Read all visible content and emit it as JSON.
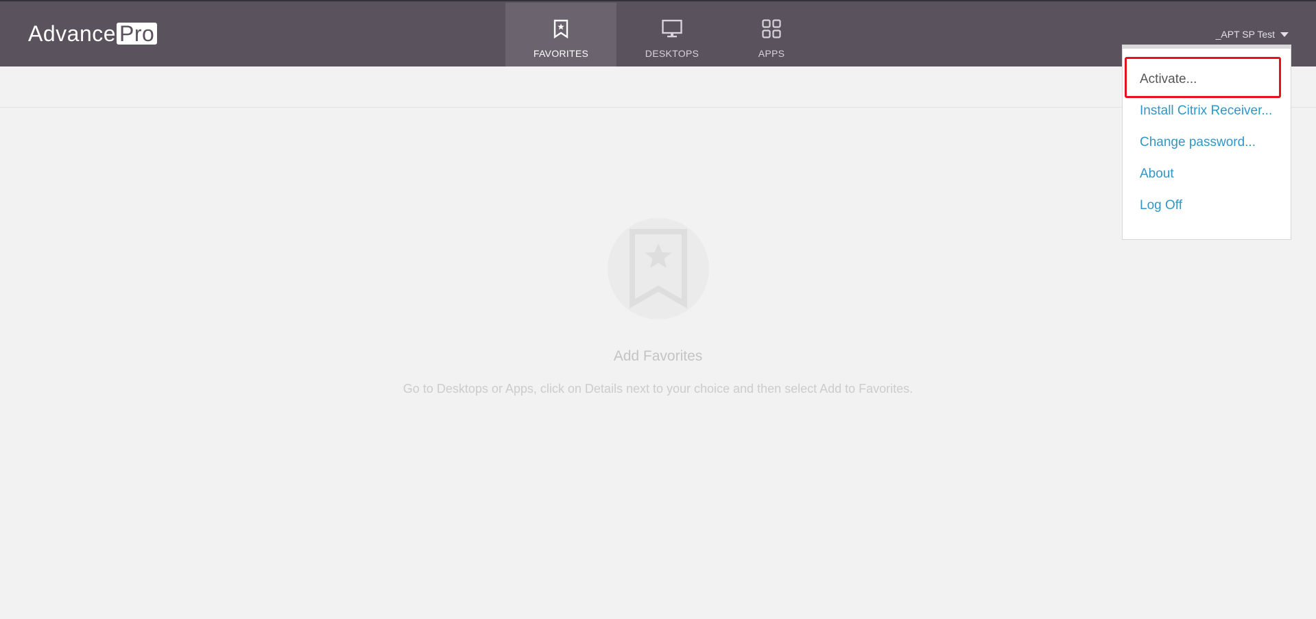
{
  "app": {
    "logo_word": "Advance",
    "logo_box": "Pro"
  },
  "nav": {
    "tabs": [
      {
        "label": "FAVORITES",
        "icon": "bookmark-star-icon",
        "active": true
      },
      {
        "label": "DESKTOPS",
        "icon": "monitor-icon",
        "active": false
      },
      {
        "label": "APPS",
        "icon": "grid-icon",
        "active": false
      }
    ]
  },
  "user": {
    "name": "_APT SP Test",
    "icon": "chevron-down-icon"
  },
  "dropdown": {
    "items": [
      {
        "label": "Activate..."
      },
      {
        "label": "Install Citrix Receiver..."
      },
      {
        "label": "Change password..."
      },
      {
        "label": "About"
      },
      {
        "label": "Log Off"
      }
    ],
    "highlighted_index": 0
  },
  "empty_state": {
    "icon": "bookmark-star-icon",
    "title": "Add Favorites",
    "message": "Go to Desktops or Apps, click on Details next to your choice and then select Add to Favorites."
  },
  "colors": {
    "topbar": "#5a525d",
    "active_tab": "#6b646e",
    "link": "#2f97c6",
    "highlight": "#e5121e",
    "background": "#f2f2f2"
  }
}
